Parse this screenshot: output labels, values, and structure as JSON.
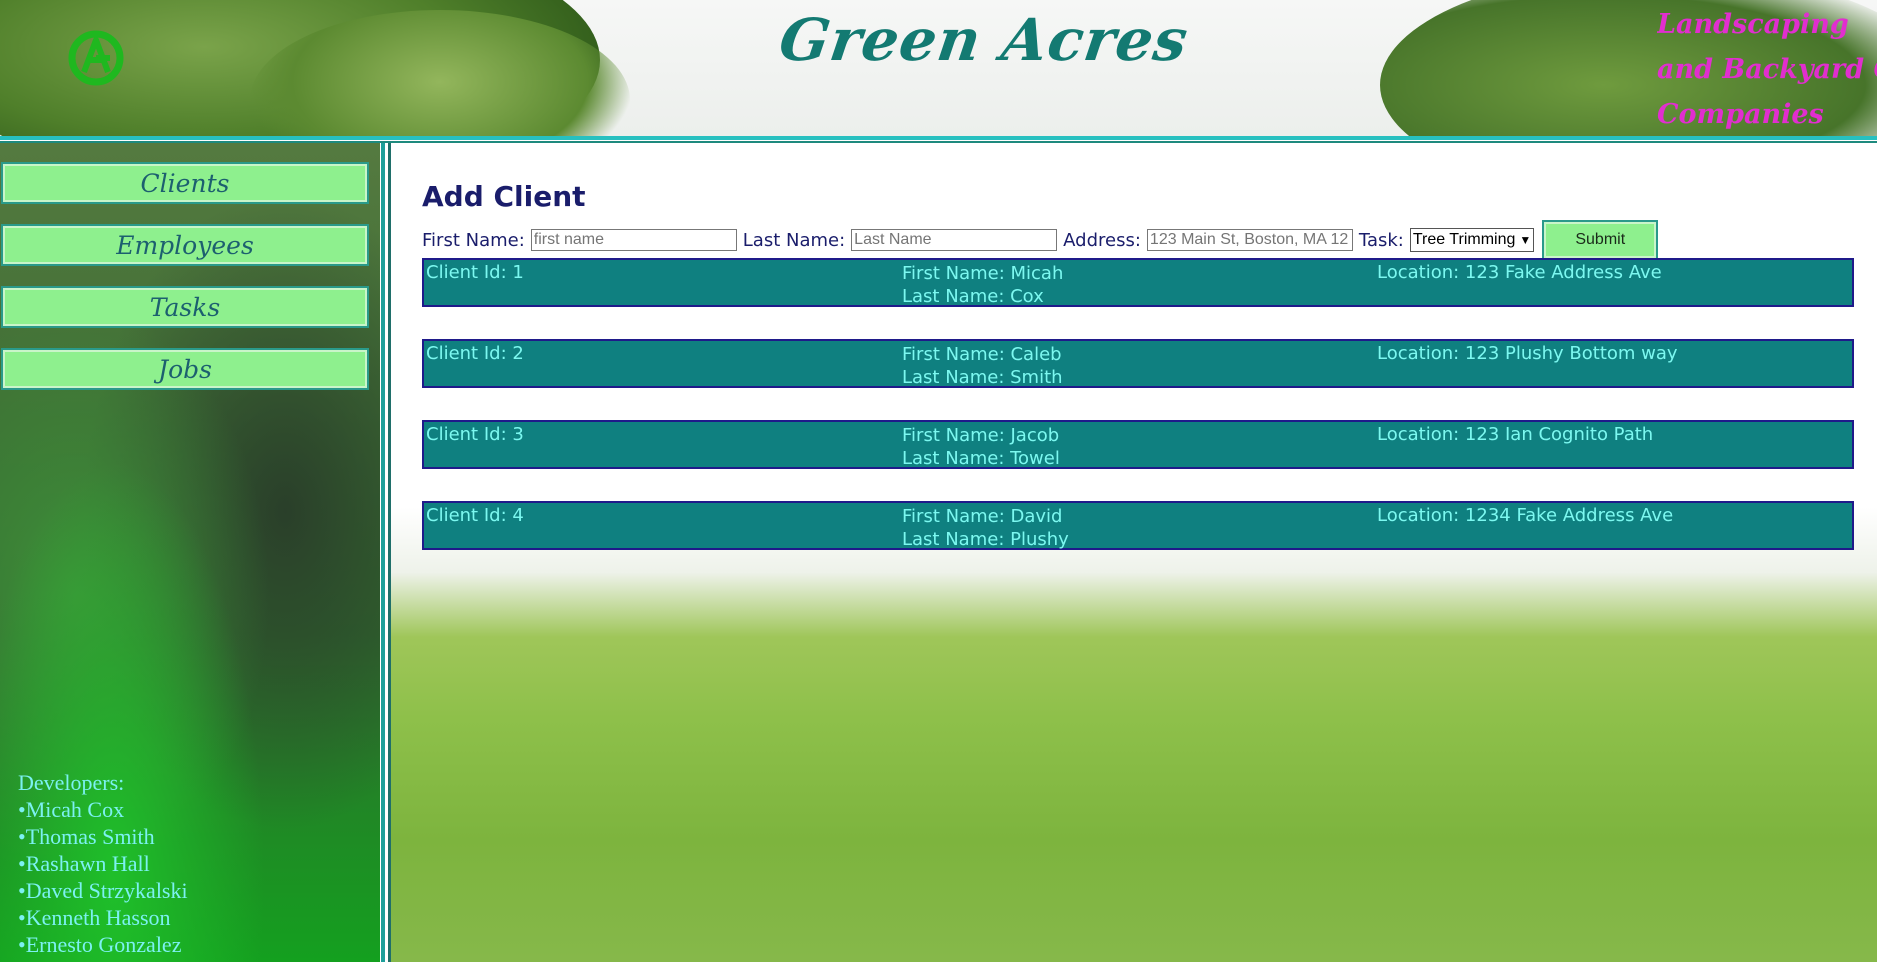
{
  "header": {
    "site_title": "Green Acres",
    "tagline_lines": [
      "Landscaping",
      "and Backyard Ca",
      "Companies"
    ],
    "logo_label": "GA"
  },
  "sidebar": {
    "nav": [
      {
        "label": "Clients"
      },
      {
        "label": "Employees"
      },
      {
        "label": "Tasks"
      },
      {
        "label": "Jobs"
      }
    ],
    "developers_title": "Developers:",
    "developers": [
      "•Micah Cox",
      "•Thomas Smith",
      "•Rashawn Hall",
      "•Daved Strzykalski",
      "•Kenneth Hasson",
      "•Ernesto Gonzalez"
    ]
  },
  "form": {
    "title": "Add Client",
    "first_name_label": "First Name:",
    "first_name_placeholder": "first name",
    "last_name_label": "Last Name:",
    "last_name_placeholder": "Last Name",
    "address_label": "Address:",
    "address_placeholder": "123 Main St, Boston, MA 12",
    "task_label": "Task:",
    "task_selected": "Tree Trimming",
    "submit_label": "Submit"
  },
  "clients": [
    {
      "id": "Client Id: 1",
      "first": "First Name: Micah",
      "last": "Last Name: Cox",
      "location": "Location: 123 Fake Address Ave"
    },
    {
      "id": "Client Id: 2",
      "first": "First Name: Caleb",
      "last": "Last Name: Smith",
      "location": "Location: 123 Plushy Bottom way"
    },
    {
      "id": "Client Id: 3",
      "first": "First Name: Jacob",
      "last": "Last Name: Towel",
      "location": "Location: 123 Ian Cognito Path"
    },
    {
      "id": "Client Id: 4",
      "first": "First Name: David",
      "last": "Last Name: Plushy",
      "location": "Location: 1234 Fake Address Ave"
    }
  ],
  "colors": {
    "title": "#137a72",
    "tagline": "#e12ecf",
    "button_bg": "#8ef08e",
    "client_bg": "#0f8080",
    "client_text": "#7cf8f0",
    "heading_text": "#1a1d6b"
  }
}
